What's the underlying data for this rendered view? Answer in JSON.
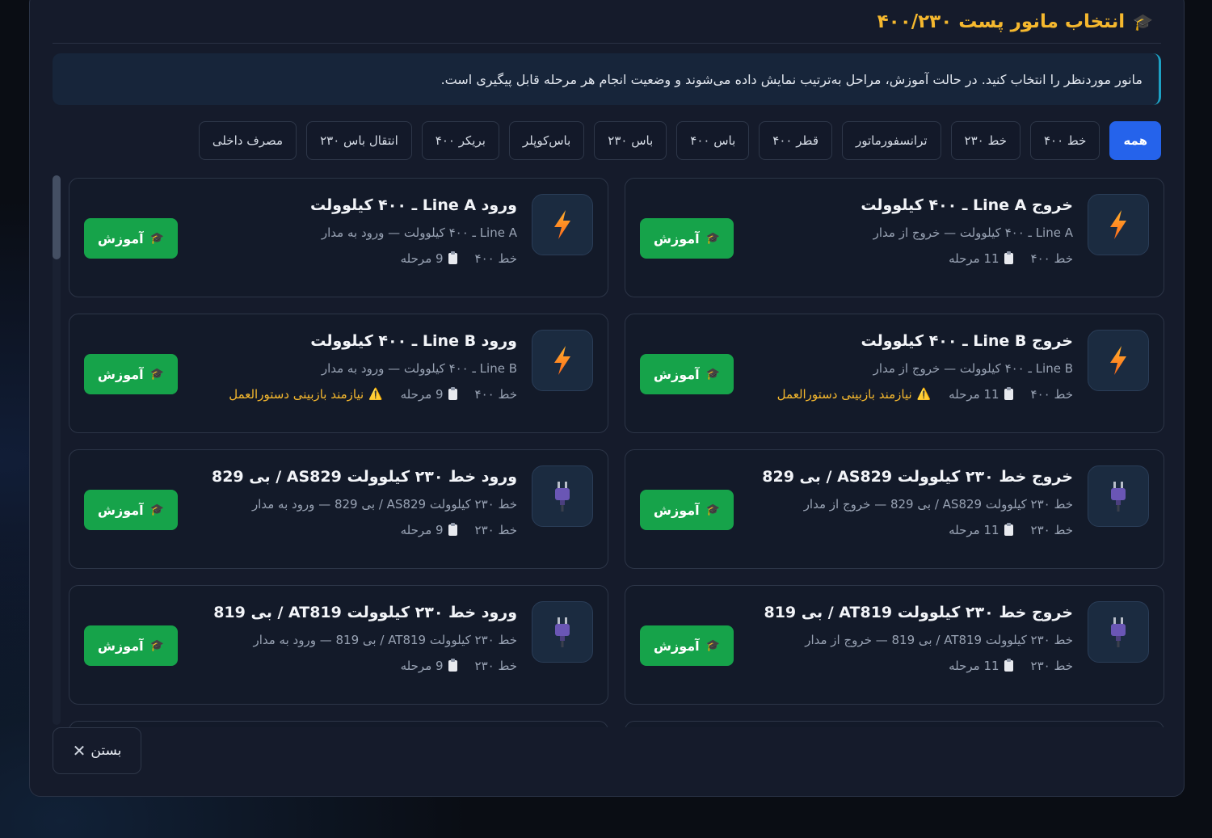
{
  "header": {
    "title": "انتخاب مانور پست ۴۰۰/۲۳۰"
  },
  "info": {
    "text": "مانور موردنظر را انتخاب کنید. در حالت آموزش، مراحل به‌ترتیب نمایش داده می‌شوند و وضعیت انجام هر مرحله قابل پیگیری است."
  },
  "filters": [
    {
      "label": "همه",
      "active": true
    },
    {
      "label": "خط ۴۰۰",
      "active": false
    },
    {
      "label": "خط ۲۳۰",
      "active": false
    },
    {
      "label": "ترانسفورماتور",
      "active": false
    },
    {
      "label": "قطر ۴۰۰",
      "active": false
    },
    {
      "label": "باس ۴۰۰",
      "active": false
    },
    {
      "label": "باس ۲۳۰",
      "active": false
    },
    {
      "label": "باس‌کوپلر",
      "active": false
    },
    {
      "label": "بریکر ۴۰۰",
      "active": false
    },
    {
      "label": "انتقال باس ۲۳۰",
      "active": false
    },
    {
      "label": "مصرف داخلی",
      "active": false
    }
  ],
  "cards": [
    {
      "icon": "lightning-icon",
      "title": "خروج Line A ـ ۴۰۰ کیلوولت",
      "subtitle": "Line A ـ ۴۰۰ کیلوولت — خروج از مدار",
      "line": "خط ۴۰۰",
      "steps": "11 مرحله",
      "warning": "",
      "button": "آموزش"
    },
    {
      "icon": "lightning-icon",
      "title": "ورود Line A ـ ۴۰۰ کیلوولت",
      "subtitle": "Line A ـ ۴۰۰ کیلوولت — ورود به مدار",
      "line": "خط ۴۰۰",
      "steps": "9 مرحله",
      "warning": "",
      "button": "آموزش"
    },
    {
      "icon": "lightning-icon",
      "title": "خروج Line B ـ ۴۰۰ کیلوولت",
      "subtitle": "Line B ـ ۴۰۰ کیلوولت — خروج از مدار",
      "line": "خط ۴۰۰",
      "steps": "11 مرحله",
      "warning": "نیازمند بازبینی دستورالعمل",
      "button": "آموزش"
    },
    {
      "icon": "lightning-icon",
      "title": "ورود Line B ـ ۴۰۰ کیلوولت",
      "subtitle": "Line B ـ ۴۰۰ کیلوولت — ورود به مدار",
      "line": "خط ۴۰۰",
      "steps": "9 مرحله",
      "warning": "نیازمند بازبینی دستورالعمل",
      "button": "آموزش"
    },
    {
      "icon": "plug-icon",
      "title": "خروج خط ۲۳۰ کیلوولت AS829 / بی 829",
      "subtitle": "خط ۲۳۰ کیلوولت AS829 / بی 829 — خروج از مدار",
      "line": "خط ۲۳۰",
      "steps": "11 مرحله",
      "warning": "",
      "button": "آموزش"
    },
    {
      "icon": "plug-icon",
      "title": "ورود خط ۲۳۰ کیلوولت AS829 / بی 829",
      "subtitle": "خط ۲۳۰ کیلوولت AS829 / بی 829 — ورود به مدار",
      "line": "خط ۲۳۰",
      "steps": "9 مرحله",
      "warning": "",
      "button": "آموزش"
    },
    {
      "icon": "plug-icon",
      "title": "خروج خط ۲۳۰ کیلوولت AT819 / بی 819",
      "subtitle": "خط ۲۳۰ کیلوولت AT819 / بی 819 — خروج از مدار",
      "line": "خط ۲۳۰",
      "steps": "11 مرحله",
      "warning": "",
      "button": "آموزش"
    },
    {
      "icon": "plug-icon",
      "title": "ورود خط ۲۳۰ کیلوولت AT819 / بی 819",
      "subtitle": "خط ۲۳۰ کیلوولت AT819 / بی 819 — ورود به مدار",
      "line": "خط ۲۳۰",
      "steps": "9 مرحله",
      "warning": "",
      "button": "آموزش"
    }
  ],
  "close_label": "بستن",
  "colors": {
    "accent": "#2563eb",
    "title": "#f5b82e",
    "train_button": "#16a34a",
    "warning": "#f5b82e"
  }
}
